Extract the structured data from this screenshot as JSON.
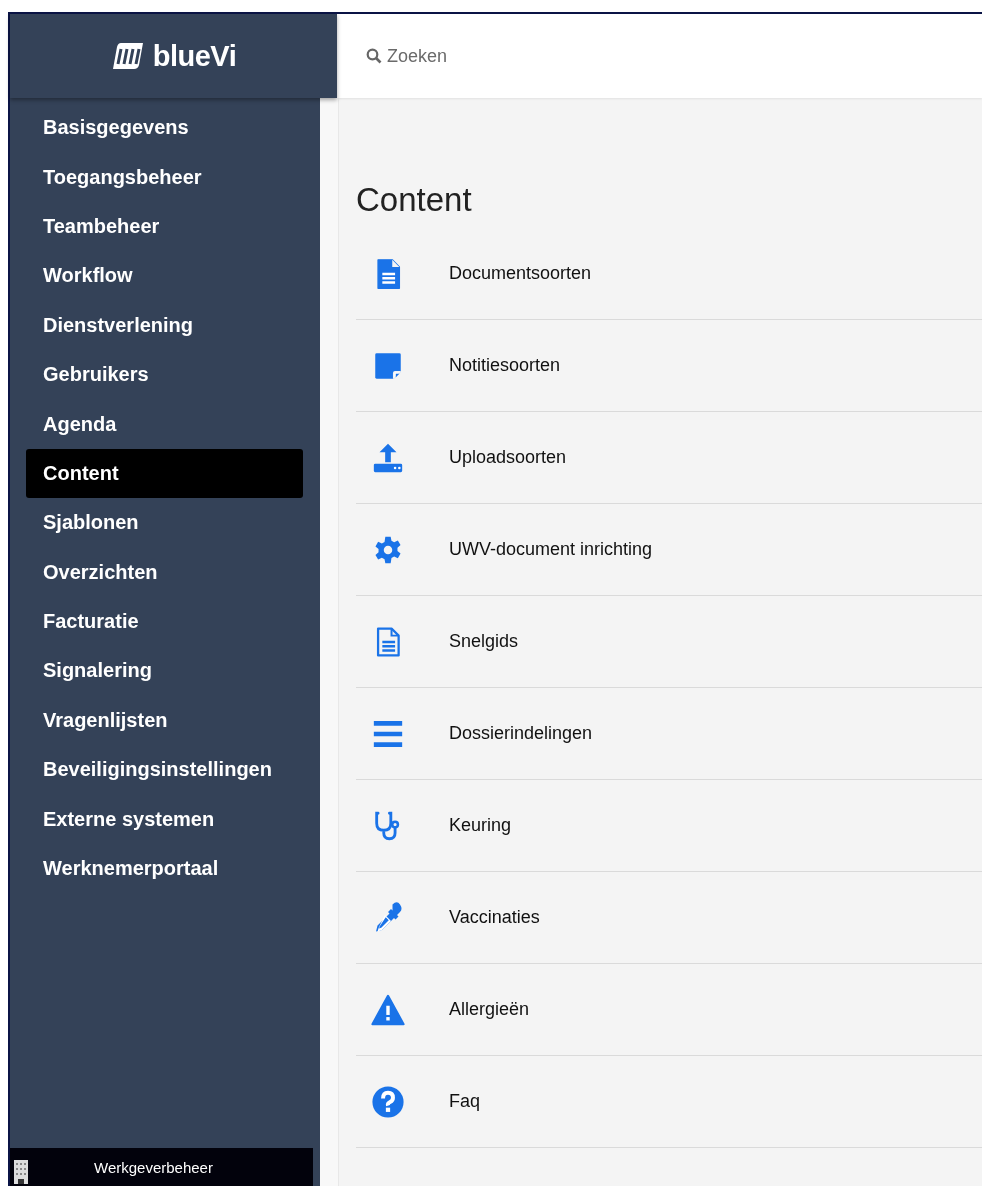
{
  "brand": {
    "name": "blueVi"
  },
  "search": {
    "placeholder": "Zoeken"
  },
  "sidebar": {
    "items": [
      {
        "label": "Basisgegevens",
        "selected": false
      },
      {
        "label": "Toegangsbeheer",
        "selected": false
      },
      {
        "label": "Teambeheer",
        "selected": false
      },
      {
        "label": "Workflow",
        "selected": false
      },
      {
        "label": "Dienstverlening",
        "selected": false
      },
      {
        "label": "Gebruikers",
        "selected": false
      },
      {
        "label": "Agenda",
        "selected": false
      },
      {
        "label": "Content",
        "selected": true
      },
      {
        "label": "Sjablonen",
        "selected": false
      },
      {
        "label": "Overzichten",
        "selected": false
      },
      {
        "label": "Facturatie",
        "selected": false
      },
      {
        "label": "Signalering",
        "selected": false
      },
      {
        "label": "Vragenlijsten",
        "selected": false
      },
      {
        "label": "Beveiligingsinstellingen",
        "selected": false
      },
      {
        "label": "Externe systemen",
        "selected": false
      },
      {
        "label": "Werknemerportaal",
        "selected": false
      }
    ],
    "footer": "Werkgeverbeheer"
  },
  "page": {
    "title": "Content",
    "items": [
      {
        "label": "Documentsoorten"
      },
      {
        "label": "Notitiesoorten"
      },
      {
        "label": "Uploadsoorten"
      },
      {
        "label": "UWV-document inrichting"
      },
      {
        "label": "Snelgids"
      },
      {
        "label": "Dossierindelingen"
      },
      {
        "label": "Keuring"
      },
      {
        "label": "Vaccinaties"
      },
      {
        "label": "Allergieën"
      },
      {
        "label": "Faq"
      }
    ]
  }
}
